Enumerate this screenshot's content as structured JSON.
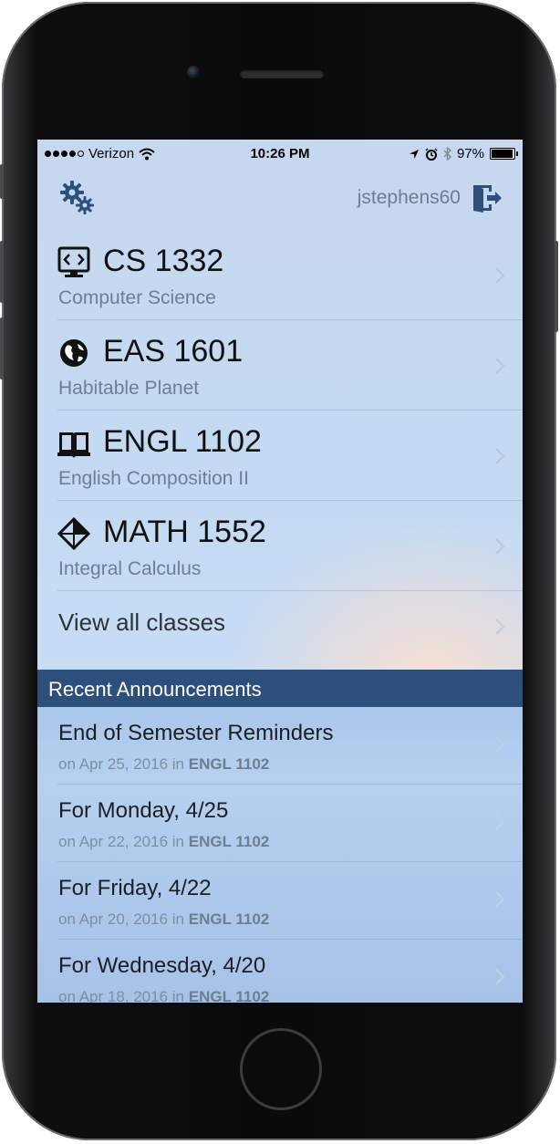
{
  "status_bar": {
    "carrier": "Verizon",
    "time": "10:26 PM",
    "battery": "97%",
    "battery_level": 0.97
  },
  "header": {
    "settings_icon": "gears-icon",
    "username": "jstephens60",
    "logout_icon": "logout-door-icon"
  },
  "classes": [
    {
      "code": "CS 1332",
      "name": "Computer Science",
      "icon": "code-monitor-icon"
    },
    {
      "code": "EAS 1601",
      "name": "Habitable Planet",
      "icon": "globe-icon"
    },
    {
      "code": "ENGL 1102",
      "name": "English Composition II",
      "icon": "book-icon"
    },
    {
      "code": "MATH 1552",
      "name": "Integral Calculus",
      "icon": "geometry-icon"
    }
  ],
  "view_all_label": "View all classes",
  "announcements_title": "Recent Announcements",
  "announcements": [
    {
      "title": "End of Semester Reminders",
      "prefix": "on Apr 25, 2016 in",
      "course": "ENGL 1102"
    },
    {
      "title": "For Monday, 4/25",
      "prefix": "on Apr 22, 2016 in",
      "course": "ENGL 1102"
    },
    {
      "title": "For Friday, 4/22",
      "prefix": "on Apr 20, 2016 in",
      "course": "ENGL 1102"
    },
    {
      "title": "For Wednesday, 4/20",
      "prefix": "on Apr 18, 2016 in",
      "course": "ENGL 1102"
    }
  ],
  "colors": {
    "banner": "#2c4f7c",
    "icon_blue": "#2d4f7a"
  }
}
